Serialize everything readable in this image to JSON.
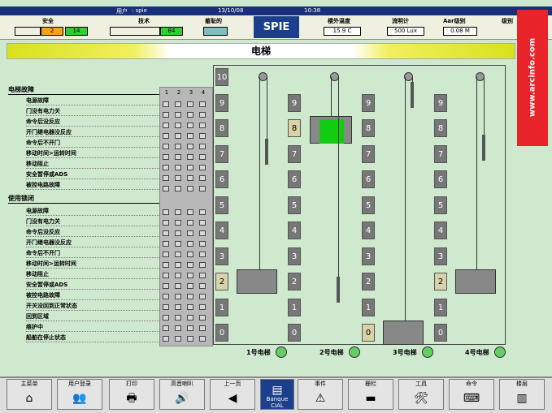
{
  "topbar": {
    "user_label": "用户",
    "user": ": spie",
    "date": "13/10/08",
    "time": "10:38"
  },
  "header": {
    "safety_label": "安全",
    "safety_a": "2",
    "safety_b": "14",
    "tech_label": "技术",
    "tech_val": "84",
    "crash_label": "羞耻的",
    "brand": "SPIE",
    "temp_label": "楼外温度",
    "temp": "15.9 C",
    "lux_label": "流明计",
    "lux": "500 Lux",
    "aar_label": "Aar级别",
    "aar": "0.08 M",
    "level_label": "级别"
  },
  "title": "电梯",
  "faults": {
    "section1": "电梯故障",
    "items1": [
      "电源故障",
      "门没有电力关",
      "命令后没反应",
      "开门继电器没反应",
      "命令后不开门",
      "移动时间>运转时间",
      "移动阻止",
      "安全暂停或ADS",
      "被控电路故障"
    ],
    "section2": "使用锁闭",
    "items2": [
      "电源故障",
      "门没有电力关",
      "命令后没反应",
      "开门继电器没反应",
      "命令后不开门",
      "移动时间>运转时间",
      "移动阻止",
      "安全暂停或ADS",
      "被控电路故障",
      "开关没回到正常状态",
      "回到区域",
      "维护中",
      "船舶在停止状态"
    ]
  },
  "grid_headers": [
    "1",
    "2",
    "3",
    "4"
  ],
  "floors": [
    "10",
    "9",
    "8",
    "7",
    "6",
    "5",
    "4",
    "3",
    "2",
    "1",
    "0"
  ],
  "elevators": [
    {
      "label": "1号电梯",
      "floor": "2"
    },
    {
      "label": "2号电梯",
      "floor": "8"
    },
    {
      "label": "3号电梯",
      "floor": "0"
    },
    {
      "label": "4号电梯",
      "floor": "2"
    }
  ],
  "watermark": "www.arcinfo.com",
  "bottom": {
    "main": "主菜单",
    "login": "用户登录",
    "print": "打印",
    "audio": "高音喇叭",
    "prev": "上一页",
    "bank": "Banque CIAL",
    "event": "事件",
    "barrier": "栅栏",
    "tools": "工具",
    "command": "命令",
    "floor": "楼层"
  }
}
